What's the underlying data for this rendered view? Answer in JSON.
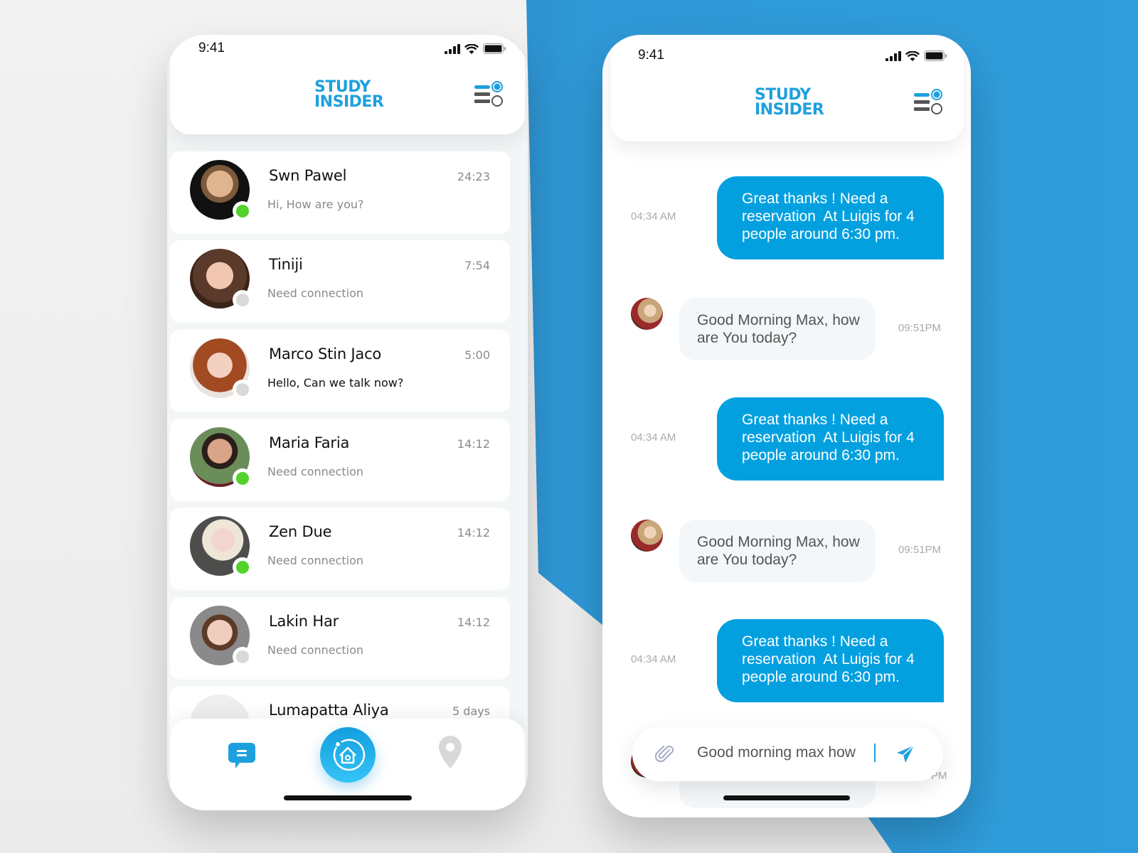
{
  "theme": {
    "brand_blue": "#1ea0de",
    "bubble_blue": "#03a0e0",
    "online_green": "#52d22b",
    "offline_gray": "#d9d9d9",
    "background_blue": "#2f9bd8"
  },
  "left_phone": {
    "status_bar": {
      "time": "9:41"
    },
    "header": {
      "logo_line1": "STUDY",
      "logo_line2": "INSIDER",
      "menu_icon": "menu-toggle-icon"
    },
    "contacts": [
      {
        "name": "Swn Pawel",
        "time": "24:23",
        "message": "Hi, How are you?",
        "status": "online",
        "unread": false
      },
      {
        "name": "Tiniji",
        "time": "7:54",
        "message": "Need connection",
        "status": "offline",
        "unread": false
      },
      {
        "name": "Marco Stin Jaco",
        "time": "5:00",
        "message": "Hello, Can we talk now?",
        "status": "offline",
        "unread": true
      },
      {
        "name": "Maria Faria",
        "time": "14:12",
        "message": "Need connection",
        "status": "online",
        "unread": false
      },
      {
        "name": "Zen Due",
        "time": "14:12",
        "message": "Need connection",
        "status": "online",
        "unread": false
      },
      {
        "name": "Lakin Har",
        "time": "14:12",
        "message": "Need connection",
        "status": "offline",
        "unread": false
      },
      {
        "name": "Lumapatta Aliya",
        "time": "5 days",
        "message": "",
        "status": "offline",
        "unread": false
      }
    ],
    "tabbar": {
      "items": [
        {
          "icon": "chat-bubble-icon",
          "active": true
        },
        {
          "icon": "home-icon",
          "active": true,
          "primary": true
        },
        {
          "icon": "location-pin-icon",
          "active": false
        }
      ]
    }
  },
  "right_phone": {
    "status_bar": {
      "time": "9:41"
    },
    "header": {
      "logo_line1": "STUDY",
      "logo_line2": "INSIDER",
      "menu_icon": "menu-toggle-icon"
    },
    "messages": [
      {
        "direction": "out",
        "lines": [
          "Great thanks ! Need a",
          "reservation  At Luigis for 4",
          "people around 6:30 pm."
        ],
        "time": "04:34 AM"
      },
      {
        "direction": "in",
        "lines": [
          "Good Morning Max, how",
          "are You today?"
        ],
        "time": "09:51PM"
      },
      {
        "direction": "out",
        "lines": [
          "Great thanks ! Need a",
          "reservation  At Luigis for 4",
          "people around 6:30 pm."
        ],
        "time": "04:34 AM"
      },
      {
        "direction": "in",
        "lines": [
          "Good Morning Max, how",
          "are You today?"
        ],
        "time": "09:51PM"
      },
      {
        "direction": "out",
        "lines": [
          "Great thanks ! Need a",
          "reservation  At Luigis for 4",
          "people around 6:30 pm."
        ],
        "time": "04:34 AM"
      },
      {
        "direction": "in",
        "lines": [
          ""
        ],
        "time": "PM"
      }
    ],
    "composer": {
      "value": "Good morning max how",
      "attach_icon": "paperclip-icon",
      "send_icon": "send-icon"
    }
  }
}
